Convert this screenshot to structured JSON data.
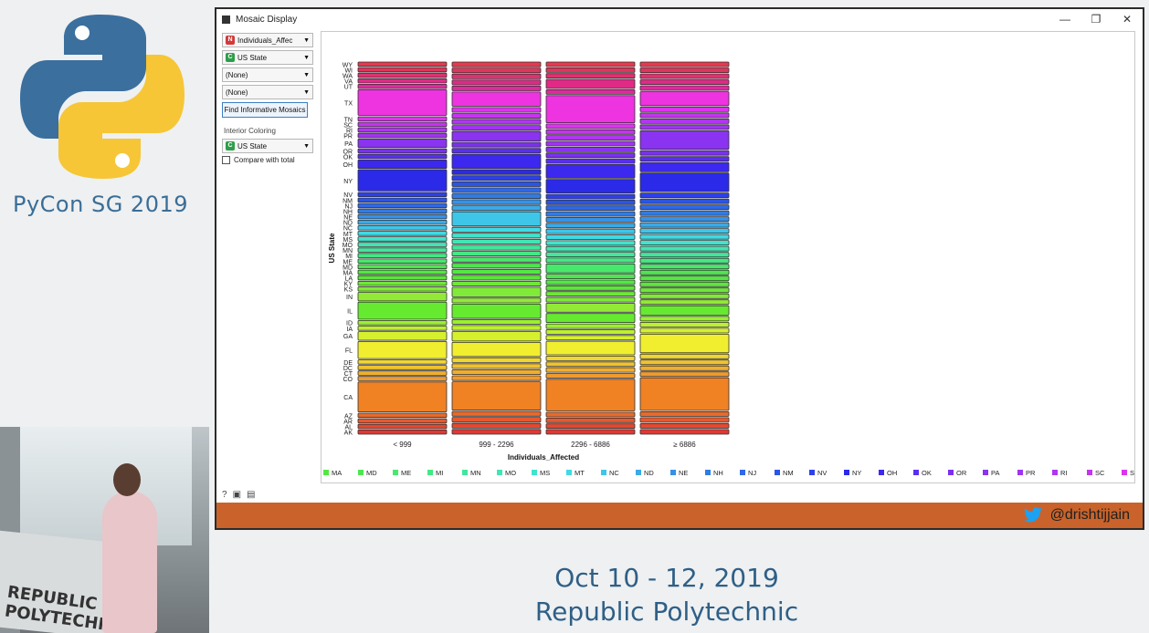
{
  "branding": {
    "conference": "PyCon SG 2019",
    "logo_icon": "python-logo-icon"
  },
  "speaker_photo": {
    "podium_text": "REPUBLIC\nPOLYTECHNIC"
  },
  "window": {
    "title": "Mosaic Display",
    "controls": {
      "minimize": "—",
      "restore": "❐",
      "close": "✕"
    }
  },
  "panel": {
    "vars": [
      {
        "badge": "N",
        "badge_color": "#d23a3a",
        "label": "Individuals_Affec"
      },
      {
        "badge": "C",
        "badge_color": "#2e9e4a",
        "label": "US State"
      },
      {
        "badge": "",
        "badge_color": "",
        "label": "(None)"
      },
      {
        "badge": "",
        "badge_color": "",
        "label": "(None)"
      }
    ],
    "find_button": "Find Informative Mosaics",
    "interior_coloring_label": "Interior Coloring",
    "interior_coloring": {
      "badge": "C",
      "badge_color": "#2e9e4a",
      "label": "US State"
    },
    "compare_label": "Compare with total",
    "compare_checked": false
  },
  "chart_data": {
    "type": "mosaic",
    "xlabel": "Individuals_Affected",
    "ylabel": "US State",
    "columns": [
      "< 999",
      "999 - 2296",
      "2296 - 6886",
      "≥ 6886"
    ],
    "row_labels": [
      "WY",
      "WI",
      "WA",
      "VA",
      "UT",
      "TX",
      "TN",
      "SC",
      "RI",
      "PR",
      "PA",
      "OR",
      "OK",
      "OH",
      "NY",
      "NV",
      "NM",
      "NJ",
      "NH",
      "NE",
      "ND",
      "NC",
      "MT",
      "MS",
      "MO",
      "MN",
      "MI",
      "ME",
      "MD",
      "MA",
      "LA",
      "KY",
      "KS",
      "IN",
      "IL",
      "ID",
      "IA",
      "GA",
      "FL",
      "DE",
      "DC",
      "CT",
      "CO",
      "CA",
      "AZ",
      "AR",
      "AL",
      "AK"
    ],
    "row_colors": [
      "#e8384f",
      "#e0345a",
      "#e03070",
      "#e02a86",
      "#de2a9c",
      "#ee33e0",
      "#dd33ee",
      "#c633f0",
      "#b036f0",
      "#a034f0",
      "#8a33f0",
      "#7a30f0",
      "#5a2ef2",
      "#3d28f0",
      "#2b2ae8",
      "#2d40ea",
      "#2a55e6",
      "#2f68e8",
      "#2f7ce6",
      "#3592e8",
      "#3aaae8",
      "#3ec6e8",
      "#3fdae4",
      "#40e4cc",
      "#40e6b4",
      "#42e69c",
      "#44e884",
      "#48e86c",
      "#4ee650",
      "#52e842",
      "#5ce63a",
      "#6ee838",
      "#80ea38",
      "#92ea36",
      "#66ea30",
      "#9af02e",
      "#bcf02e",
      "#d6f02e",
      "#f0ee2e",
      "#f0d62e",
      "#f0c22e",
      "#f0ae2e",
      "#f09a2e",
      "#f08224",
      "#e86a2a",
      "#e8582e",
      "#e44830",
      "#e03834"
    ],
    "row_heights": [
      [
        1,
        1,
        1,
        1,
        1,
        6,
        1,
        1,
        1,
        1,
        2,
        1,
        1,
        2,
        5,
        1,
        1,
        1,
        1,
        1,
        1,
        1,
        1,
        1,
        1,
        1,
        1,
        1,
        1,
        1,
        1,
        1,
        1,
        2,
        4,
        1,
        1,
        2,
        4,
        1,
        1,
        1,
        1,
        7,
        1,
        1,
        1,
        1
      ],
      [
        1,
        1,
        1,
        1,
        1,
        3,
        1,
        1,
        1,
        1,
        2,
        1,
        1,
        3,
        1,
        1,
        1,
        1,
        1,
        1,
        1,
        3,
        1,
        1,
        1,
        1,
        1,
        1,
        1,
        1,
        1,
        1,
        2,
        1,
        3,
        1,
        1,
        2,
        3,
        1,
        1,
        1,
        1,
        6,
        1,
        1,
        1,
        1
      ],
      [
        1,
        1,
        1,
        2,
        1,
        6,
        1,
        1,
        1,
        1,
        1,
        1,
        1,
        3,
        3,
        1,
        1,
        1,
        1,
        1,
        1,
        1,
        1,
        1,
        1,
        1,
        1,
        2,
        1,
        1,
        1,
        1,
        1,
        2,
        2,
        1,
        1,
        1,
        3,
        1,
        1,
        1,
        1,
        7,
        1,
        1,
        1,
        1
      ],
      [
        1,
        1,
        1,
        1,
        1,
        3,
        1,
        1,
        1,
        1,
        4,
        1,
        1,
        2,
        4,
        1,
        1,
        1,
        1,
        1,
        1,
        1,
        1,
        1,
        1,
        1,
        1,
        1,
        1,
        1,
        1,
        1,
        1,
        1,
        2,
        1,
        1,
        1,
        4,
        1,
        1,
        1,
        1,
        7,
        1,
        1,
        1,
        1
      ]
    ],
    "legend": [
      "MA",
      "MD",
      "ME",
      "MI",
      "MN",
      "MO",
      "MS",
      "MT",
      "NC",
      "ND",
      "NE",
      "NH",
      "NJ",
      "NM",
      "NV",
      "NY",
      "OH",
      "OK",
      "OR",
      "PA",
      "PR",
      "RI",
      "SC",
      "S"
    ],
    "legend_colors": [
      "#52e842",
      "#4ee650",
      "#48e86c",
      "#44e884",
      "#42e69c",
      "#40e6b4",
      "#40e4cc",
      "#3fdae4",
      "#3ec6e8",
      "#3aaae8",
      "#3592e8",
      "#2f7ce6",
      "#2f68e8",
      "#2a55e6",
      "#2d40ea",
      "#2b2ae8",
      "#3d28f0",
      "#5a2ef2",
      "#7a30f0",
      "#8a33f0",
      "#a034f0",
      "#b036f0",
      "#c633f0",
      "#dd33ee"
    ]
  },
  "status": {
    "twitter_icon": "twitter-bird-icon",
    "handle": "@drishtijjain"
  },
  "event": {
    "date": "Oct 10 - 12, 2019",
    "venue": "Republic Polytechnic"
  },
  "bottom_icons": [
    "help-icon",
    "save-icon",
    "report-icon"
  ]
}
